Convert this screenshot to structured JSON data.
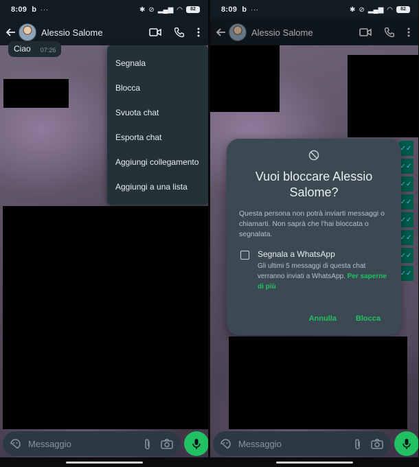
{
  "status_bar": {
    "time": "8:09",
    "app_letter": "b",
    "more": "···",
    "battery": "82"
  },
  "header": {
    "contact_name": "Alessio Salome"
  },
  "chat": {
    "message_text": "Ciao",
    "message_time": "07:26"
  },
  "menu": {
    "items": [
      {
        "label": "Segnala"
      },
      {
        "label": "Blocca"
      },
      {
        "label": "Svuota chat"
      },
      {
        "label": "Esporta chat"
      },
      {
        "label": "Aggiungi collegamento"
      },
      {
        "label": "Aggiungi a una lista"
      }
    ]
  },
  "composer": {
    "placeholder": "Messaggio"
  },
  "dialog": {
    "title": "Vuoi bloccare Alessio Salome?",
    "description": "Questa persona non potrà inviarti messaggi o chiamarti. Non saprà che l'hai bloccata o segnalata.",
    "checkbox_label": "Segnala a WhatsApp",
    "checkbox_desc": "Gli ultimi 5 messaggi di questa chat verranno inviati a WhatsApp.",
    "learn_more": "Per saperne di più",
    "cancel_label": "Annulla",
    "confirm_label": "Blocca"
  },
  "colors": {
    "accent": "#21c063",
    "header_bg": "#121b22",
    "menu_bg": "#233138",
    "dialog_bg": "#3b4a52"
  }
}
